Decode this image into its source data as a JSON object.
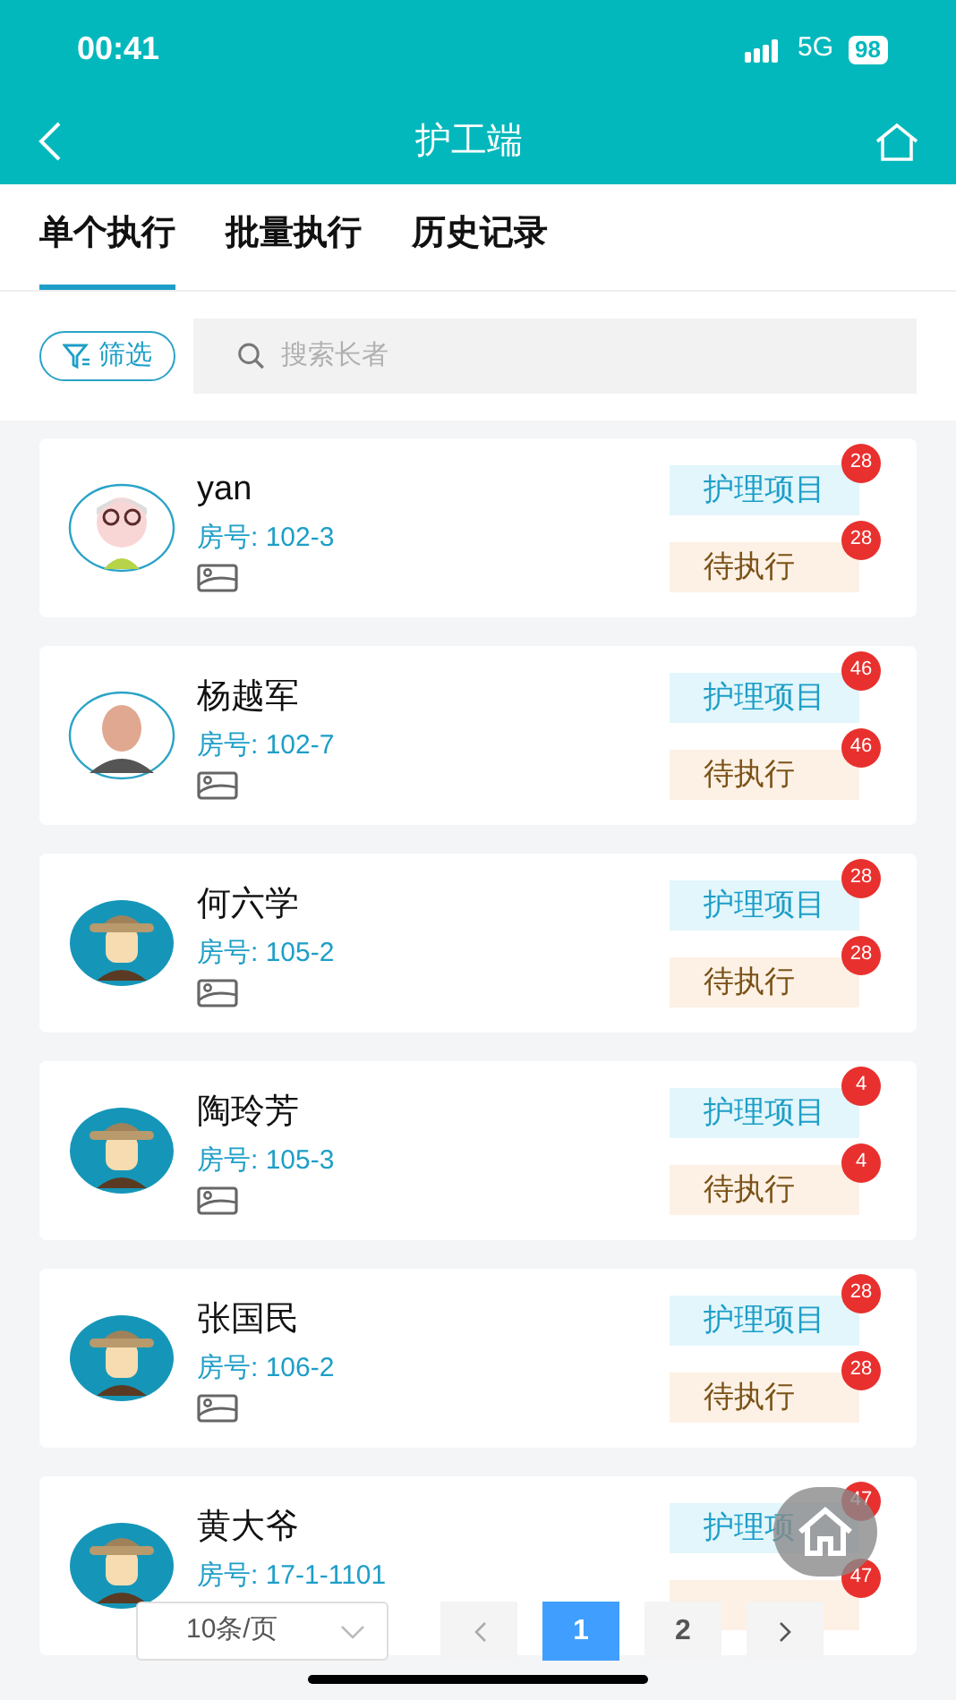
{
  "status_bar": {
    "time": "00:41",
    "network": "5G",
    "battery": "98"
  },
  "header": {
    "title": "护工端"
  },
  "tabs": [
    {
      "label": "单个执行",
      "selected": true
    },
    {
      "label": "批量执行",
      "selected": false
    },
    {
      "label": "历史记录",
      "selected": false
    }
  ],
  "filter": {
    "label": "筛选"
  },
  "search": {
    "placeholder": "搜索长者"
  },
  "residents": [
    {
      "name": "yan",
      "room": "房号: 102-3",
      "kind": "cartoon-elder",
      "care_label": "护理项目",
      "care_count": "28",
      "pending_label": "待执行",
      "pending_count": "28"
    },
    {
      "name": "杨越军",
      "room": "房号: 102-7",
      "kind": "photo",
      "care_label": "护理项目",
      "care_count": "46",
      "pending_label": "待执行",
      "pending_count": "46"
    },
    {
      "name": "何六学",
      "room": "房号: 105-2",
      "kind": "hat-figure",
      "care_label": "护理项目",
      "care_count": "28",
      "pending_label": "待执行",
      "pending_count": "28"
    },
    {
      "name": "陶玲芳",
      "room": "房号: 105-3",
      "kind": "hat-figure",
      "care_label": "护理项目",
      "care_count": "4",
      "pending_label": "待执行",
      "pending_count": "4"
    },
    {
      "name": "张国民",
      "room": "房号: 106-2",
      "kind": "hat-figure",
      "care_label": "护理项目",
      "care_count": "28",
      "pending_label": "待执行",
      "pending_count": "28"
    },
    {
      "name": "黄大爷",
      "room": "房号: 17-1-1101",
      "kind": "hat-figure",
      "care_label": "护理项",
      "care_count": "47",
      "pending_count": "47"
    }
  ],
  "pagination": {
    "page_size": "10条/页",
    "pages": [
      {
        "label": "1",
        "selected": true
      },
      {
        "label": "2",
        "selected": false
      }
    ]
  }
}
